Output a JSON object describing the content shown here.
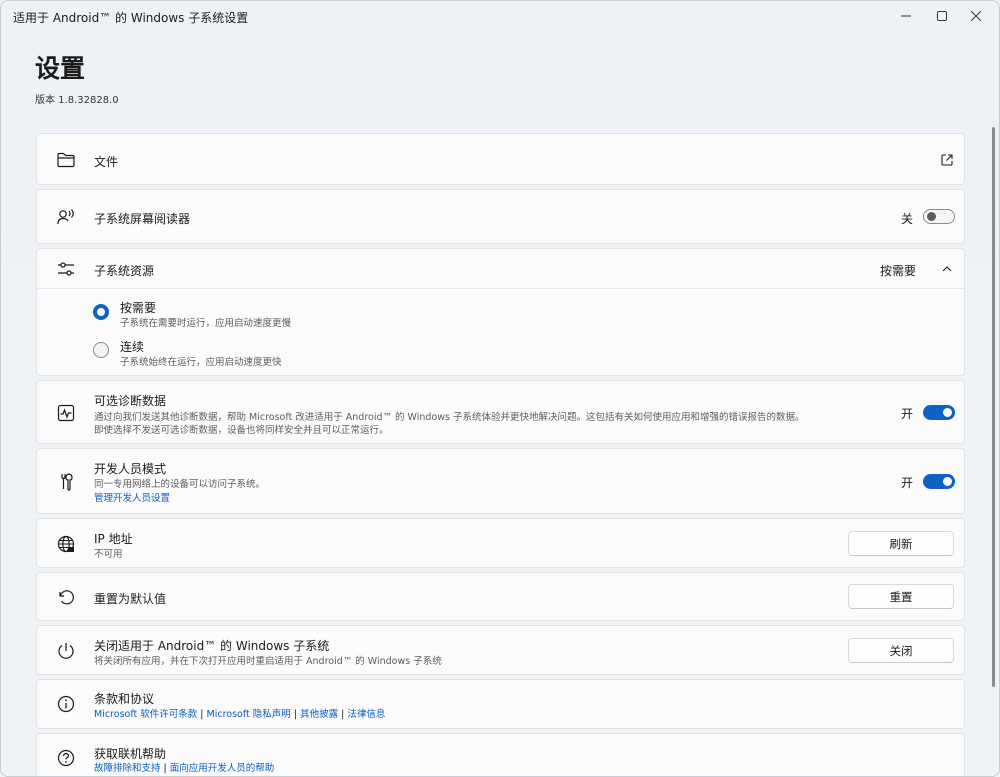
{
  "window": {
    "title": "适用于 Android™ 的 Windows 子系统设置",
    "controls": [
      "minimize-icon",
      "maximize-icon",
      "close-icon"
    ]
  },
  "header": {
    "title": "设置",
    "version": "版本 1.8.32828.0"
  },
  "files": {
    "label": "文件",
    "icon": "folder-icon",
    "action_icon": "open-external-icon"
  },
  "screen_reader": {
    "label": "子系统屏幕阅读器",
    "icon": "narrator-icon",
    "state": "关",
    "on": false
  },
  "resources": {
    "label": "子系统资源",
    "icon": "sliders-icon",
    "value": "按需要",
    "options": [
      {
        "label": "按需要",
        "desc": "子系统在需要时运行，应用启动速度更慢",
        "selected": true
      },
      {
        "label": "连续",
        "desc": "子系统始终在运行，应用启动速度更快",
        "selected": false
      }
    ]
  },
  "diagnostics": {
    "label": "可选诊断数据",
    "icon": "activity-icon",
    "desc1": "通过向我们发送其他诊断数据，帮助 Microsoft 改进适用于 Android™ 的 Windows 子系统体验并更快地解决问题。这包括有关如何使用应用和增强的错误报告的数据。",
    "desc2": "即使选择不发送可选诊断数据，设备也将同样安全并且可以正常运行。",
    "state": "开",
    "on": true
  },
  "developer": {
    "label": "开发人员模式",
    "icon": "tools-icon",
    "desc": "同一专用网络上的设备可以访问子系统。",
    "link": "管理开发人员设置",
    "state": "开",
    "on": true
  },
  "ip": {
    "label": "IP 地址",
    "icon": "globe-icon",
    "desc": "不可用",
    "button": "刷新"
  },
  "reset": {
    "label": "重置为默认值",
    "icon": "reset-icon",
    "button": "重置"
  },
  "shutdown": {
    "label": "关闭适用于 Android™ 的 Windows 子系统",
    "icon": "power-icon",
    "desc": "将关闭所有应用，并在下次打开应用时重启适用于 Android™ 的 Windows 子系统",
    "button": "关闭"
  },
  "terms": {
    "label": "条款和协议",
    "icon": "info-icon",
    "links": [
      "Microsoft 软件许可条款",
      "Microsoft 隐私声明",
      "其他披露",
      "法律信息"
    ],
    "separator": "|"
  },
  "help": {
    "label": "获取联机帮助",
    "icon": "help-icon",
    "links": [
      "故障排除和支持",
      "面向应用开发人员的帮助"
    ],
    "separator": "|"
  },
  "colors": {
    "accent": "#0f62c4",
    "link": "#0a5ec2",
    "card": "#fbfbfc",
    "background": "#eef2f6"
  }
}
